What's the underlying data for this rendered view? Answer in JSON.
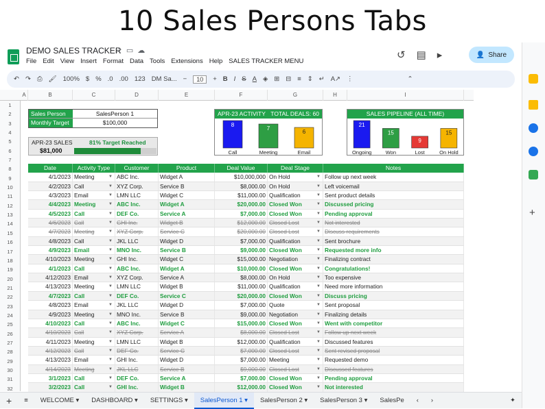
{
  "banner": {
    "title": "10 Sales Persons Tabs"
  },
  "app": {
    "doc_title": "DEMO SALES TRACKER",
    "menu": [
      "File",
      "Edit",
      "View",
      "Insert",
      "Format",
      "Data",
      "Tools",
      "Extensions",
      "Help",
      "SALES TRACKER MENU"
    ],
    "share_label": "Share"
  },
  "toolbar": {
    "zoom": "100%",
    "currency": "$",
    "percent": "%",
    "decimals": ".0",
    "decimals2": ".00",
    "format": "123",
    "font": "DM Sa...",
    "font_size": "10"
  },
  "columns": [
    "A",
    "B",
    "C",
    "D",
    "E",
    "F",
    "G",
    "H",
    "I"
  ],
  "rows": [
    "1",
    "2",
    "3",
    "4",
    "5",
    "6",
    "7",
    "8",
    "9",
    "10",
    "11",
    "12",
    "13",
    "14",
    "15",
    "16",
    "17",
    "18",
    "19",
    "20",
    "21",
    "22",
    "23",
    "24",
    "25",
    "26",
    "27",
    "28",
    "29",
    "30",
    "31",
    "32"
  ],
  "summary": {
    "person_label": "Sales Person",
    "person_value": "SalesPerson 1",
    "target_label": "Monthly Target",
    "target_value": "$100,000",
    "sales_label": "APR-23 SALES",
    "sales_pct_label": "81% Target Reached",
    "sales_amount": "$81,000",
    "sales_pct": 0.81
  },
  "activity": {
    "title": "APR-23 ACTIVITY",
    "total": "TOTAL DEALS: 60",
    "chart_data": {
      "type": "bar",
      "categories": [
        "Call",
        "Meeting",
        "Email"
      ],
      "values": [
        8,
        7,
        6
      ],
      "colors": [
        "#1a1af0",
        "#2e9e44",
        "#f5b400"
      ]
    }
  },
  "pipeline": {
    "title": "SALES PIPELINE (ALL TIME)",
    "chart_data": {
      "type": "bar",
      "categories": [
        "Ongoing",
        "Won",
        "Lost",
        "On Hold"
      ],
      "values": [
        21,
        15,
        9,
        15
      ],
      "colors": [
        "#1a1af0",
        "#2e9e44",
        "#e53935",
        "#f5b400"
      ]
    }
  },
  "table": {
    "headers": [
      "Date",
      "Activity Type",
      "Customer",
      "Product",
      "Deal Value",
      "Deal Stage",
      "Notes"
    ],
    "rows": [
      {
        "date": "4/1/2023",
        "type": "Meeting",
        "customer": "ABC Inc.",
        "product": "Widget A",
        "value": "$10,000,000",
        "stage": "On Hold",
        "notes": "Follow up next week",
        "status": "normal"
      },
      {
        "date": "4/2/2023",
        "type": "Call",
        "customer": "XYZ Corp.",
        "product": "Service B",
        "value": "$8,000.00",
        "stage": "On Hold",
        "notes": "Left voicemail",
        "status": "normal"
      },
      {
        "date": "4/3/2023",
        "type": "Email",
        "customer": "LMN LLC",
        "product": "Widget C",
        "value": "$11,000.00",
        "stage": "Qualification",
        "notes": "Sent product details",
        "status": "normal"
      },
      {
        "date": "4/4/2023",
        "type": "Meeting",
        "customer": "ABC Inc.",
        "product": "Widget A",
        "value": "$20,000.00",
        "stage": "Closed Won",
        "notes": "Discussed pricing",
        "status": "won"
      },
      {
        "date": "4/5/2023",
        "type": "Call",
        "customer": "DEF Co.",
        "product": "Service A",
        "value": "$7,000.00",
        "stage": "Closed Won",
        "notes": "Pending approval",
        "status": "won"
      },
      {
        "date": "4/6/2023",
        "type": "Call",
        "customer": "GHI Inc.",
        "product": "Widget B",
        "value": "$12,000.00",
        "stage": "Closed Lost",
        "notes": "Not interested",
        "status": "lost"
      },
      {
        "date": "4/7/2023",
        "type": "Meeting",
        "customer": "XYZ Corp.",
        "product": "Service C",
        "value": "$20,000.00",
        "stage": "Closed Lost",
        "notes": "Discuss requirements",
        "status": "lost"
      },
      {
        "date": "4/8/2023",
        "type": "Call",
        "customer": "JKL LLC",
        "product": "Widget D",
        "value": "$7,000.00",
        "stage": "Qualification",
        "notes": "Sent brochure",
        "status": "normal"
      },
      {
        "date": "4/9/2023",
        "type": "Email",
        "customer": "MNO Inc.",
        "product": "Service B",
        "value": "$9,000.00",
        "stage": "Closed Won",
        "notes": "Requested more info",
        "status": "won"
      },
      {
        "date": "4/10/2023",
        "type": "Meeting",
        "customer": "GHI Inc.",
        "product": "Widget C",
        "value": "$15,000.00",
        "stage": "Negotiation",
        "notes": "Finalizing contract",
        "status": "normal"
      },
      {
        "date": "4/1/2023",
        "type": "Call",
        "customer": "ABC Inc.",
        "product": "Widget A",
        "value": "$10,000.00",
        "stage": "Closed Won",
        "notes": "Congratulations!",
        "status": "won"
      },
      {
        "date": "4/12/2023",
        "type": "Email",
        "customer": "XYZ Corp.",
        "product": "Service A",
        "value": "$8,000.00",
        "stage": "On Hold",
        "notes": "Too expensive",
        "status": "normal"
      },
      {
        "date": "4/13/2023",
        "type": "Meeting",
        "customer": "LMN LLC",
        "product": "Widget B",
        "value": "$11,000.00",
        "stage": "Qualification",
        "notes": "Need more information",
        "status": "normal"
      },
      {
        "date": "4/7/2023",
        "type": "Call",
        "customer": "DEF Co.",
        "product": "Service C",
        "value": "$20,000.00",
        "stage": "Closed Won",
        "notes": "Discuss pricing",
        "status": "won"
      },
      {
        "date": "4/8/2023",
        "type": "Email",
        "customer": "JKL LLC",
        "product": "Widget D",
        "value": "$7,000.00",
        "stage": "Quote",
        "notes": "Sent proposal",
        "status": "normal"
      },
      {
        "date": "4/9/2023",
        "type": "Meeting",
        "customer": "MNO Inc.",
        "product": "Service B",
        "value": "$9,000.00",
        "stage": "Negotiation",
        "notes": "Finalizing details",
        "status": "normal"
      },
      {
        "date": "4/10/2023",
        "type": "Call",
        "customer": "ABC Inc.",
        "product": "Widget C",
        "value": "$15,000.00",
        "stage": "Closed Won",
        "notes": "Went with competitor",
        "status": "won"
      },
      {
        "date": "4/10/2023",
        "type": "Call",
        "customer": "XYZ Corp.",
        "product": "Service A",
        "value": "$8,000.00",
        "stage": "Closed Lost",
        "notes": "Follow up next week",
        "status": "lost"
      },
      {
        "date": "4/11/2023",
        "type": "Meeting",
        "customer": "LMN LLC",
        "product": "Widget B",
        "value": "$12,000.00",
        "stage": "Qualification",
        "notes": "Discussed features",
        "status": "normal"
      },
      {
        "date": "4/12/2023",
        "type": "Call",
        "customer": "DEF Co.",
        "product": "Service C",
        "value": "$7,000.00",
        "stage": "Closed Lost",
        "notes": "Sent revised proposal",
        "status": "lost"
      },
      {
        "date": "4/13/2023",
        "type": "Email",
        "customer": "GHI Inc.",
        "product": "Widget D",
        "value": "$7,000.00",
        "stage": "Meeting",
        "notes": "Requested demo",
        "status": "normal"
      },
      {
        "date": "4/14/2023",
        "type": "Meeting",
        "customer": "JKL LLC",
        "product": "Service B",
        "value": "$9,000.00",
        "stage": "Closed Lost",
        "notes": "Discussed features",
        "status": "lost"
      },
      {
        "date": "3/1/2023",
        "type": "Call",
        "customer": "DEF Co.",
        "product": "Service A",
        "value": "$7,000.00",
        "stage": "Closed Won",
        "notes": "Pending approval",
        "status": "won"
      },
      {
        "date": "3/2/2023",
        "type": "Call",
        "customer": "GHI Inc.",
        "product": "Widget B",
        "value": "$12,000.00",
        "stage": "Closed Won",
        "notes": "Not interested",
        "status": "won"
      }
    ]
  },
  "tabs": [
    "WELCOME",
    "DASHBOARD",
    "SETTINGS",
    "SalesPerson 1",
    "SalesPerson 2",
    "SalesPerson 3",
    "SalesPe"
  ],
  "active_tab": "SalesPerson 1"
}
